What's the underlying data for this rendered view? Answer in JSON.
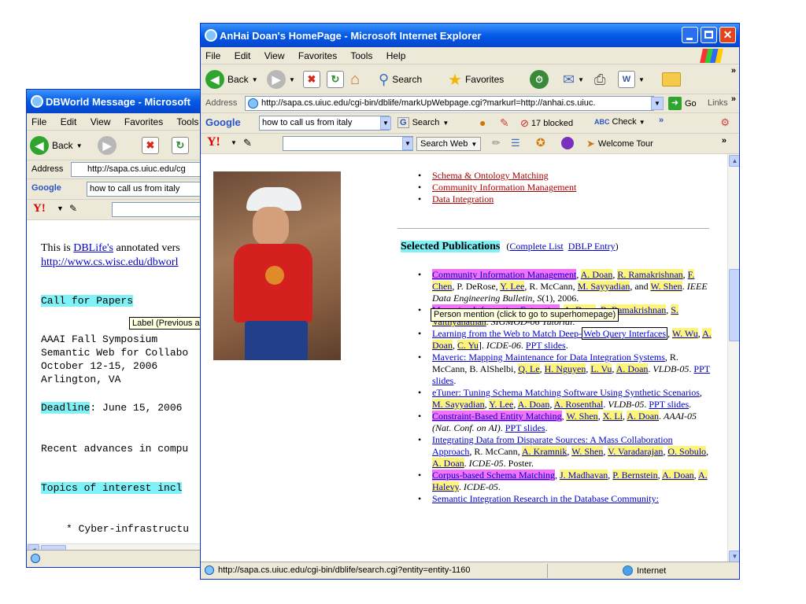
{
  "back_window": {
    "title": "DBWorld Message - Microsoft",
    "menu": [
      "File",
      "Edit",
      "View",
      "Favorites",
      "Tools"
    ],
    "toolbar": {
      "back_label": "Back"
    },
    "address_label": "Address",
    "address_url": "http://sapa.cs.uiuc.edu/cg",
    "google_label": "Google",
    "google_query": "how to call us from italy",
    "content": {
      "intro_prefix": "This is ",
      "intro_link": "DBLife's",
      "intro_suffix": " annotated vers",
      "url_link": "http://www.cs.wisc.edu/dbworl",
      "call_for_papers": "Call for Papers",
      "tooltip": "Label (Previous a",
      "lines": [
        "AAAI Fall Symposium",
        "Semantic Web for Collabo",
        "October 12-15, 2006",
        "Arlington, VA"
      ],
      "deadline_label": "Deadline",
      "deadline_rest": ": June 15, 2006",
      "recent": "Recent advances in compu",
      "topics": "Topics of interest incl",
      "bullet": "* Cyber-infrastructu"
    }
  },
  "front_window": {
    "title": "AnHai Doan's HomePage - Microsoft Internet Explorer",
    "menu": [
      "File",
      "Edit",
      "View",
      "Favorites",
      "Tools",
      "Help"
    ],
    "toolbar": {
      "back_label": "Back",
      "search_label": "Search",
      "favorites_label": "Favorites"
    },
    "address_label": "Address",
    "address_url": "http://sapa.cs.uiuc.edu/cgi-bin/dblife/markUpWebpage.cgi?markurl=http://anhai.cs.uiuc.",
    "go_label": "Go",
    "links_label": "Links",
    "google": {
      "label": "Google",
      "query": "how to call us from italy",
      "search_label": "Search",
      "blocked_label": "17 blocked",
      "check_label": "Check"
    },
    "yahoo": {
      "label": "Y!",
      "search_web_label": "Search Web",
      "welcome_tour_label": "Welcome Tour"
    },
    "status_url": "http://sapa.cs.uiuc.edu/cgi-bin/dblife/search.cgi?entity=entity-1160",
    "zone_label": "Internet"
  },
  "page": {
    "top_links": [
      "Schema & Ontology Matching",
      "Community Information Management",
      "Data Integration"
    ],
    "section_title": "Selected Publications",
    "complete_list": "Complete List",
    "dblp_entry": "DBLP Entry",
    "tooltip": "Person mention (click to go to superhomepage)"
  },
  "colors": {
    "cyan_highlight": "#7ff2f7",
    "yellow_highlight": "#fdf57a",
    "magenta_highlight": "#f472f9",
    "title_blue": "#0A5FE5",
    "close_red": "#E04520"
  }
}
